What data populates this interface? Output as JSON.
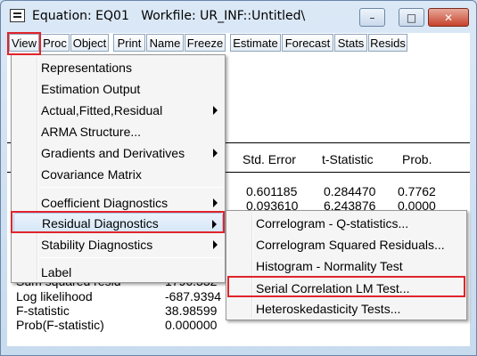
{
  "window": {
    "title": "Equation: EQ01   Workfile: UR_INF::Untitled\\",
    "buttons": {
      "minimize": "–",
      "maximize": "□",
      "close": "✕"
    }
  },
  "toolbar": {
    "items": [
      "View",
      "Proc",
      "Object",
      "Print",
      "Name",
      "Freeze",
      "Estimate",
      "Forecast",
      "Stats",
      "Resids"
    ]
  },
  "table": {
    "headers": [
      "Std. Error",
      "t-Statistic",
      "Prob."
    ],
    "rows": [
      [
        "0.601185",
        "0.284470",
        "0.7762"
      ],
      [
        "0.093610",
        "6.243876",
        "0.0000"
      ]
    ],
    "stats": [
      {
        "label": "Sum squared resid",
        "value": "1796.332"
      },
      {
        "label": "Log likelihood",
        "value": "-687.9394"
      },
      {
        "label": "F-statistic",
        "value": "38.98599"
      },
      {
        "label": "Prob(F-statistic)",
        "value": "0.000000"
      }
    ]
  },
  "view_menu": {
    "items": [
      {
        "label": "Representations"
      },
      {
        "label": "Estimation Output"
      },
      {
        "label": "Actual,Fitted,Residual",
        "submenu": true
      },
      {
        "label": "ARMA Structure..."
      },
      {
        "label": "Gradients and Derivatives",
        "submenu": true
      },
      {
        "label": "Covariance Matrix"
      },
      {
        "label": "Coefficient Diagnostics",
        "submenu": true
      },
      {
        "label": "Residual Diagnostics",
        "submenu": true
      },
      {
        "label": "Stability Diagnostics",
        "submenu": true
      },
      {
        "label": "Label"
      }
    ]
  },
  "residual_submenu": {
    "items": [
      {
        "label": "Correlogram - Q-statistics..."
      },
      {
        "label": "Correlogram Squared Residuals..."
      },
      {
        "label": "Histogram - Normality Test"
      },
      {
        "label": "Serial Correlation LM Test..."
      },
      {
        "label": "Heteroskedasticity Tests..."
      }
    ]
  },
  "highlight_color": "#e0242b"
}
